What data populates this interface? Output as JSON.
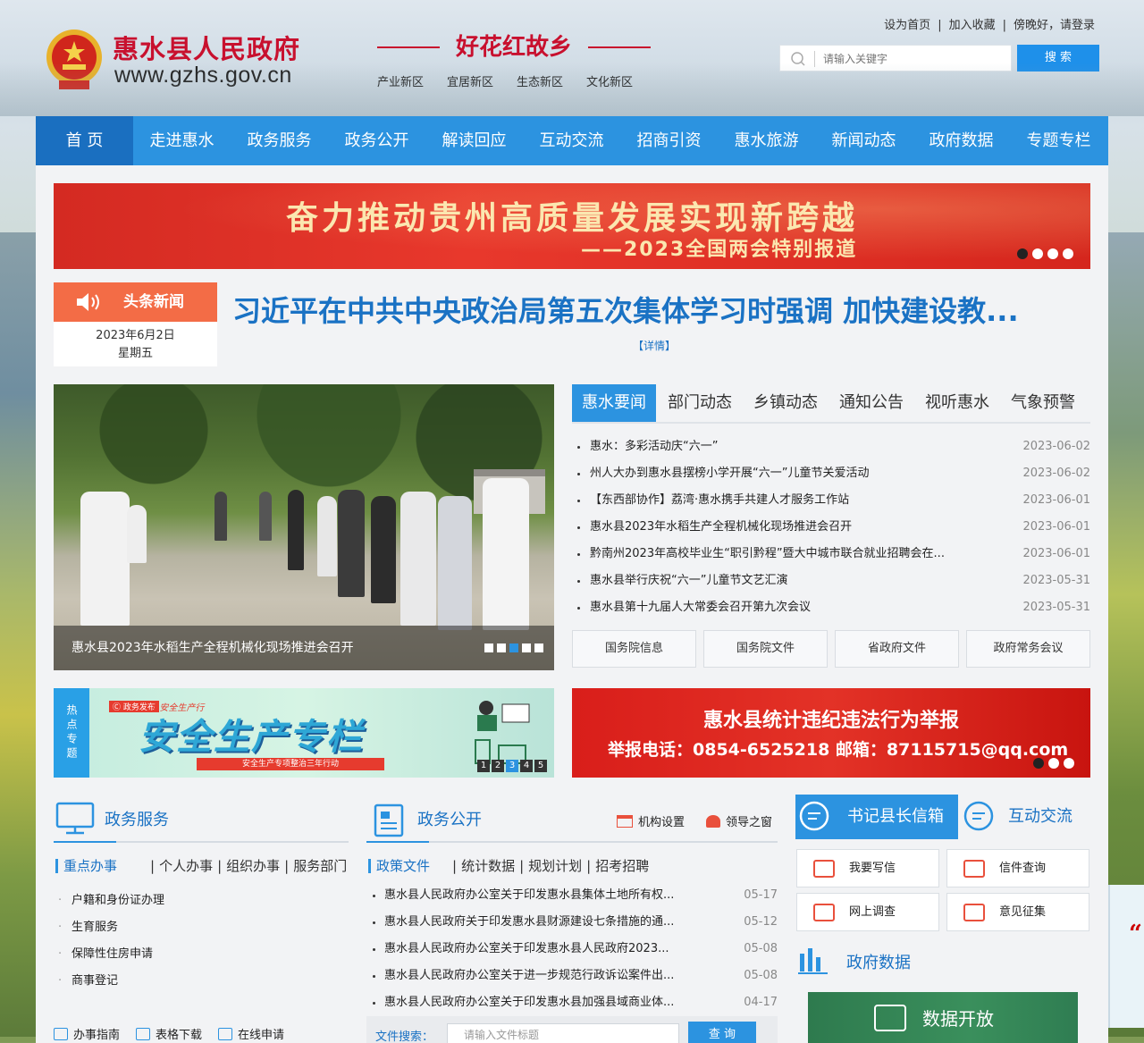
{
  "header": {
    "site_name": "惠水县人民政府",
    "site_url": "www.gzhs.gov.cn",
    "slogan": "好花红故乡",
    "zones": [
      "产业新区",
      "宜居新区",
      "生态新区",
      "文化新区"
    ],
    "top_links": [
      "设为首页",
      "加入收藏",
      "傍晚好，请登录"
    ],
    "search_placeholder": "请输入关键字",
    "search_button": "搜 索"
  },
  "nav": {
    "items": [
      "首 页",
      "走进惠水",
      "政务服务",
      "政务公开",
      "解读回应",
      "互动交流",
      "招商引资",
      "惠水旅游",
      "新闻动态",
      "政府数据",
      "专题专栏"
    ],
    "active_index": 0
  },
  "banner": {
    "title": "奋力推动贵州高质量发展实现新跨越",
    "subtitle": "——2023全国两会特别报道",
    "slide_count": 4,
    "active_slide": 1
  },
  "headline": {
    "tag": "头条新闻",
    "date": "2023年6月2日",
    "weekday": "星期五",
    "title": "习近平在中共中央政治局第五次集体学习时强调 加快建设教...",
    "more": "【详情】"
  },
  "photo_news": {
    "caption": "惠水县2023年水稻生产全程机械化现场推进会召开",
    "slide_count": 5,
    "active_slide": 3
  },
  "news_tabs": {
    "tabs": [
      "惠水要闻",
      "部门动态",
      "乡镇动态",
      "通知公告",
      "视听惠水",
      "气象预警"
    ],
    "active_index": 0,
    "items": [
      {
        "title": "惠水：多彩活动庆“六一”",
        "date": "2023-06-02"
      },
      {
        "title": "州人大办到惠水县摆榜小学开展“六一”儿童节关爱活动",
        "date": "2023-06-02"
      },
      {
        "title": "【东西部协作】荔湾·惠水携手共建人才服务工作站",
        "date": "2023-06-01"
      },
      {
        "title": "惠水县2023年水稻生产全程机械化现场推进会召开",
        "date": "2023-06-01"
      },
      {
        "title": "黔南州2023年高校毕业生“职引黔程”暨大中城市联合就业招聘会在...",
        "date": "2023-06-01"
      },
      {
        "title": "惠水县举行庆祝“六一”儿童节文艺汇演",
        "date": "2023-05-31"
      },
      {
        "title": "惠水县第十九届人大常委会召开第九次会议",
        "date": "2023-05-31"
      }
    ],
    "quick_links": [
      "国务院信息",
      "国务院文件",
      "省政府文件",
      "政府常务会议"
    ]
  },
  "special": {
    "label": "热点专题",
    "tag_small": "Ⓒ 政务发布",
    "tag_script": "#安全生产行",
    "title": "安全生产专栏",
    "strip": "安全生产专项整治三年行动",
    "pages": [
      "1",
      "2",
      "3",
      "4",
      "5"
    ],
    "active_page": 3
  },
  "report": {
    "title": "惠水县统计违纪违法行为举报",
    "line": "举报电话：0854-6525218  邮箱：87115715@qq.com",
    "slide_count": 3,
    "active_slide": 1
  },
  "services": {
    "title": "政务服务",
    "sub_tabs": [
      "重点办事",
      "个人办事",
      "组织办事",
      "服务部门"
    ],
    "items": [
      "户籍和身份证办理",
      "生育服务",
      "保障性住房申请",
      "商事登记"
    ],
    "footer": [
      "办事指南",
      "表格下载",
      "在线申请"
    ]
  },
  "open_gov": {
    "title": "政务公开",
    "links": [
      "机构设置",
      "领导之窗"
    ],
    "sub_tabs": [
      "政策文件",
      "统计数据",
      "规划计划",
      "招考招聘"
    ],
    "items": [
      {
        "title": "惠水县人民政府办公室关于印发惠水县集体土地所有权...",
        "date": "05-17"
      },
      {
        "title": "惠水县人民政府关于印发惠水县财源建设七条措施的通...",
        "date": "05-12"
      },
      {
        "title": "惠水县人民政府办公室关于印发惠水县人民政府2023...",
        "date": "05-08"
      },
      {
        "title": "惠水县人民政府办公室关于进一步规范行政诉讼案件出...",
        "date": "05-08"
      },
      {
        "title": "惠水县人民政府办公室关于印发惠水县加强县域商业体...",
        "date": "04-17"
      }
    ],
    "search_label": "文件搜索：",
    "search_placeholder": "请输入文件标题",
    "search_button": "查 询"
  },
  "interaction": {
    "tab_active": "书记县长信箱",
    "tab_other": "互动交流",
    "buttons": [
      "我要写信",
      "信件查询",
      "网上调查",
      "意见征集"
    ],
    "data_title": "政府数据",
    "data_open": "数据开放"
  },
  "colors": {
    "nav_blue": "#2c93e0",
    "nav_active": "#1a6fc0",
    "brand_red": "#c8102e",
    "headline_orange": "#f36c46",
    "title_blue": "#1a72c4"
  }
}
